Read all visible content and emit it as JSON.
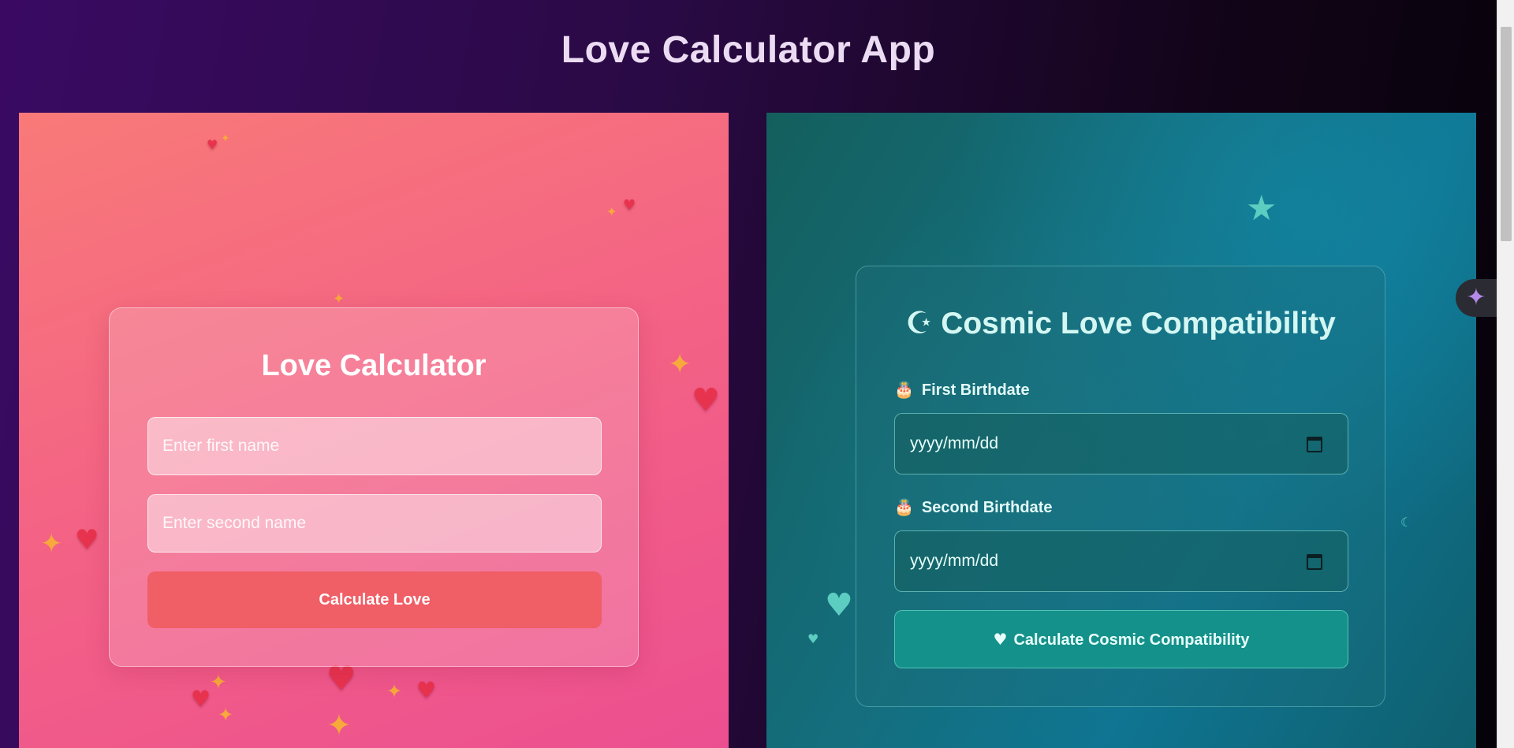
{
  "app": {
    "title": "Love Calculator App"
  },
  "love": {
    "title": "Love Calculator",
    "first_placeholder": "Enter first name",
    "second_placeholder": "Enter second name",
    "button_label": "Calculate Love"
  },
  "cosmic": {
    "moon_icon": "☪",
    "title": "Cosmic Love Compatibility",
    "first_label": "First Birthdate",
    "second_label": "Second Birthdate",
    "cake_icon": "🎂",
    "first_date_value": "yyyy/mm/dd",
    "second_date_value": "yyyy/mm/dd",
    "heart_icon": "♥",
    "button_label": "Calculate Cosmic Compatibility"
  },
  "widget": {
    "icon": "✦"
  },
  "colors": {
    "love_accent": "#f05e66",
    "cosmic_accent": "#14918a",
    "title_color": "#ecdcf3"
  }
}
